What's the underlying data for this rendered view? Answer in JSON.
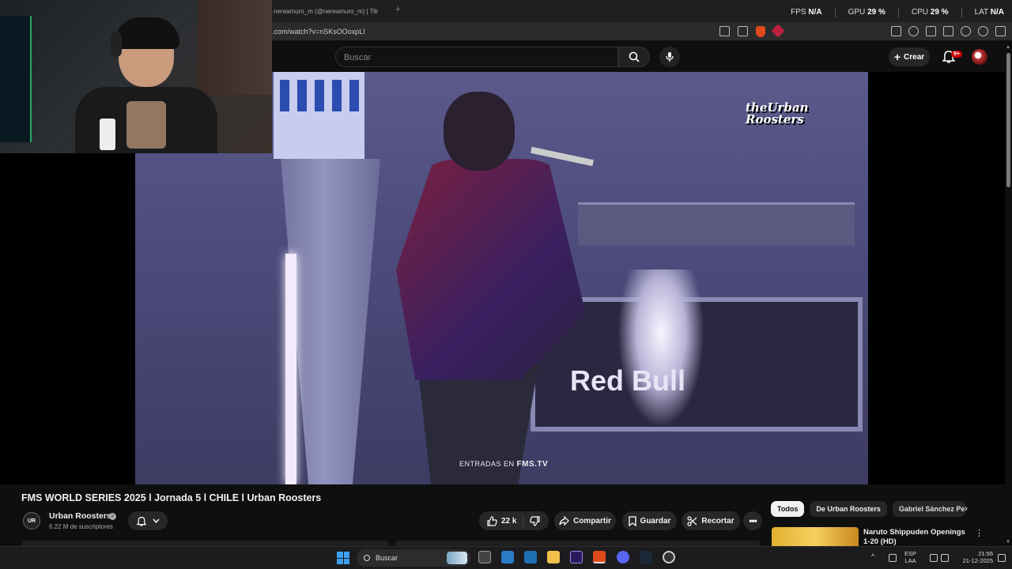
{
  "browser": {
    "tab_title": "nereamuro_m (@nereamuro_m) | Tik",
    "new_tab_symbol": "+",
    "url": ".com/watch?v=nSKsOOoxpLI",
    "perf": [
      {
        "label": "FPS",
        "value": "N/A"
      },
      {
        "label": "GPU",
        "value": "29 %"
      },
      {
        "label": "CPU",
        "value": "29 %"
      },
      {
        "label": "LAT",
        "value": "N/A"
      }
    ]
  },
  "header": {
    "search_placeholder": "Buscar",
    "create_label": "Crear",
    "notifications_badge": "9+"
  },
  "video": {
    "watermark": "theUrban Roosters",
    "caption_prefix": "ENTRADAS EN ",
    "caption_site": "FMS.TV",
    "stage_brand": "Red Bull"
  },
  "video_info": {
    "title": "FMS WORLD SERIES 2025 l Jornada 5 l CHILE l Urban Roosters",
    "channel_avatar_text": "UR",
    "channel_name": "Urban Roosters",
    "subscribers": "6.22 M de suscriptores",
    "likes": "22 k",
    "share_label": "Compartir",
    "save_label": "Guardar",
    "clip_label": "Recortar"
  },
  "sidebar": {
    "chips": [
      "Todos",
      "De Urban Roosters",
      "Gabriel Sánchez Pe"
    ],
    "recommendation_title": "Naruto Shippuden Openings 1-20 (HD)"
  },
  "taskbar": {
    "search_label": "Buscar",
    "language_line1": "ESP",
    "language_line2": "LAA",
    "time": "21:56",
    "date": "21-12-2025"
  },
  "colors": {
    "background": "#0f0f0f",
    "chip_active": "#f1f1f1",
    "notification_badge": "#cc0000",
    "windows_accent": "#3ca0f0"
  }
}
